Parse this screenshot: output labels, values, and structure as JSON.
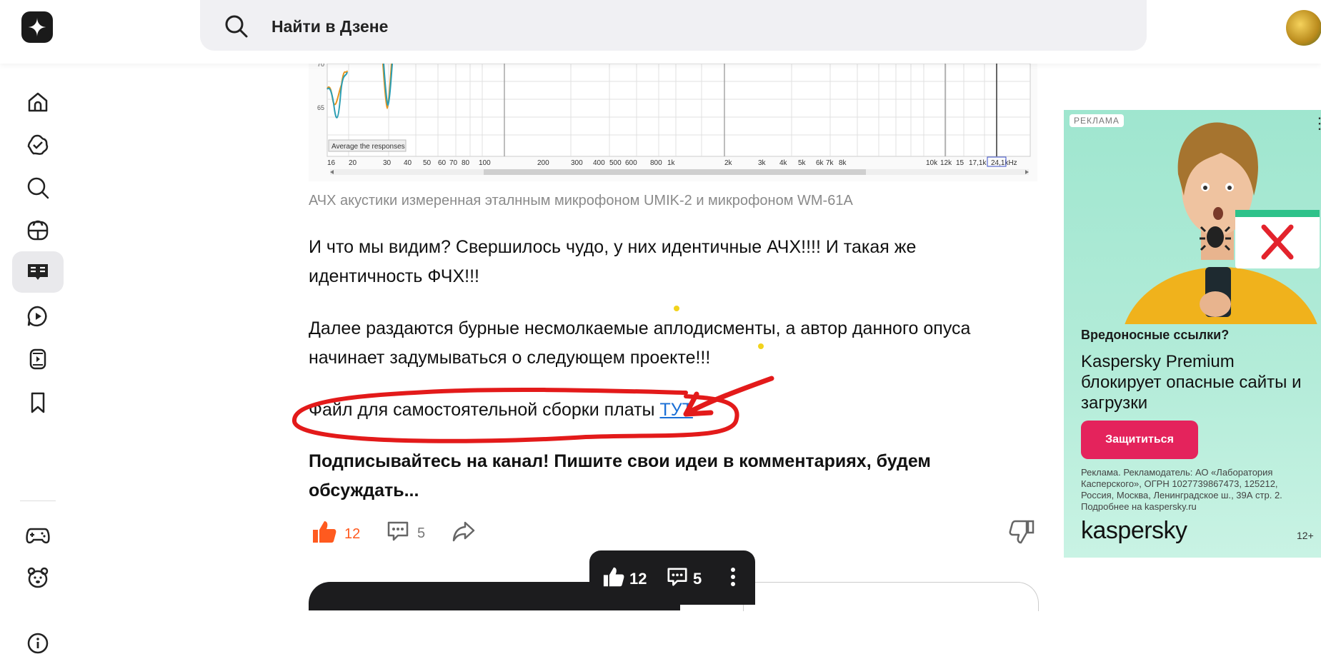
{
  "search": {
    "placeholder": "Найти в Дзене"
  },
  "sidebar": {
    "items": [
      {
        "icon": "home-icon"
      },
      {
        "icon": "subscriptions-icon"
      },
      {
        "icon": "search-icon"
      },
      {
        "icon": "channels-icon"
      },
      {
        "icon": "articles-icon",
        "active": true
      },
      {
        "icon": "video-icon"
      },
      {
        "icon": "shorts-icon"
      },
      {
        "icon": "bookmark-icon"
      },
      {
        "icon": "games-icon"
      },
      {
        "icon": "kids-icon"
      },
      {
        "icon": "info-icon"
      }
    ]
  },
  "chart": {
    "y_ticks": [
      "70",
      "65"
    ],
    "x_ticks": [
      "16",
      "20",
      "30",
      "40",
      "50",
      "60",
      "70",
      "80",
      "100",
      "200",
      "300",
      "400",
      "500",
      "600",
      "800",
      "1k",
      "2k",
      "3k",
      "4k",
      "5k",
      "6k",
      "7k",
      "8k",
      "10k",
      "12k",
      "15",
      "17,1k",
      "24,1kHz"
    ],
    "legend": "Average the responses"
  },
  "article": {
    "caption": "АЧХ акустики измеренная эталнным микрофоном UMIK-2 и микрофоном WM-61A",
    "p1": "И что мы видим? Свершилось чудо, у них идентичные АЧХ!!!! И такая же идентичность ФЧХ!!!",
    "p2": "Далее раздаются бурные несмолкаемые аплодисменты, а автор данного опуса начинает задумываться о следующем проекте!!!",
    "p3_text": "Файл для самостоятельной сборки платы ",
    "p3_link": "ТУТ",
    "p4": "Подписывайтесь на канал! Пишите свои идеи в комментариях, будем обсуждать..."
  },
  "actions": {
    "likes": "12",
    "comments": "5"
  },
  "floatbar": {
    "likes": "12",
    "comments": "5"
  },
  "ad": {
    "tag": "РЕКЛАМА",
    "headline": "Вредоносные ссылки?",
    "body": "Kaspersky Premium блокирует опасные сайты и загрузки",
    "button": "Защититься",
    "legal": "Реклама. Рекламодатель: АО «Лаборатория Касперского», ОГРН 1027739867473, 125212, Россия, Москва, Ленинградское ш., 39А стр. 2. Подробнее на kaspersky.ru",
    "brand": "kaspersky",
    "age": "12+"
  },
  "colors": {
    "accent": "#ff5a1f",
    "link": "#1a6fd6",
    "ad_button": "#e4235c",
    "annotation": "#e31a1a"
  }
}
